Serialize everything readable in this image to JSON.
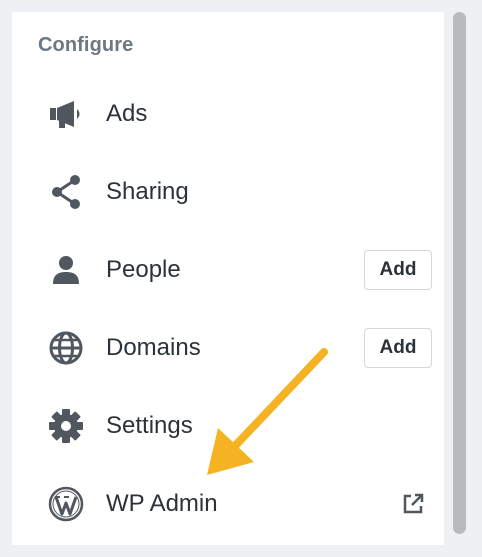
{
  "section": {
    "title": "Configure"
  },
  "menu": {
    "items": [
      {
        "label": "Ads",
        "icon": "megaphone-icon"
      },
      {
        "label": "Sharing",
        "icon": "share-icon"
      },
      {
        "label": "People",
        "icon": "person-icon",
        "action_label": "Add"
      },
      {
        "label": "Domains",
        "icon": "globe-icon",
        "action_label": "Add"
      },
      {
        "label": "Settings",
        "icon": "gear-icon"
      },
      {
        "label": "WP Admin",
        "icon": "wordpress-icon",
        "trailing_icon": "external-link-icon"
      }
    ]
  },
  "colors": {
    "icon": "#50575e",
    "text": "#2c3338",
    "section_title": "#6d7882",
    "annotation_arrow": "#f5b324",
    "scrollbar": "#b9babc"
  }
}
